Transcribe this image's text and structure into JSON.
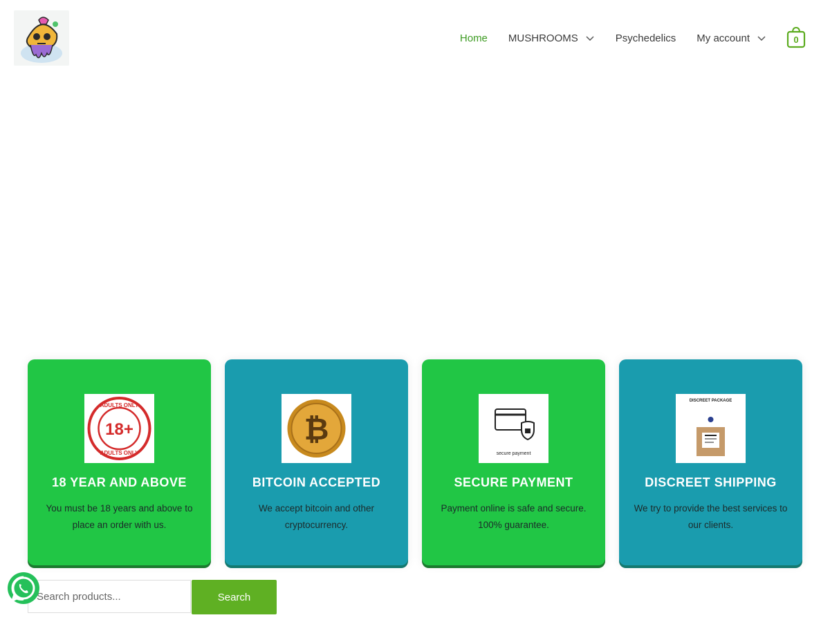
{
  "header": {
    "logo_icon": "mushroom-skull-logo",
    "nav": [
      {
        "label": "Home",
        "active": true,
        "dropdown": false
      },
      {
        "label": "MUSHROOMS",
        "active": false,
        "dropdown": true
      },
      {
        "label": "Psychedelics",
        "active": false,
        "dropdown": false
      },
      {
        "label": "My account",
        "active": false,
        "dropdown": true
      }
    ],
    "cart": {
      "icon": "shopping-bag-icon",
      "count": "0"
    }
  },
  "features": [
    {
      "title": "18 YEAR AND ABOVE",
      "text": "You must be 18 years and above to place an order with us.",
      "icon": "adults-only-stamp",
      "stamp_text": "18+",
      "stamp_ring": "ADULTS ONLY",
      "color": "#21c645"
    },
    {
      "title": "BITCOIN ACCEPTED",
      "text": "We accept bitcoin and other cryptocurrency.",
      "icon": "bitcoin-coin",
      "color": "#1a9cae"
    },
    {
      "title": "SECURE PAYMENT",
      "text": "Payment online is safe and secure. 100% guarantee.",
      "icon": "secure-card",
      "caption": "secure payment",
      "color": "#21c645"
    },
    {
      "title": "DISCREET SHIPPING",
      "text": "We try to provide the best services to our clients.",
      "icon": "discreet-package",
      "caption": "DISCREET PACKAGE",
      "color": "#1a9cae"
    }
  ],
  "search": {
    "placeholder": "Search products...",
    "button_label": "Search"
  },
  "whatsapp": {
    "icon": "whatsapp-icon"
  },
  "colors": {
    "accent": "#3d9b22",
    "green_card": "#21c645",
    "teal_card": "#1a9cae",
    "search_button": "#5fb023"
  }
}
